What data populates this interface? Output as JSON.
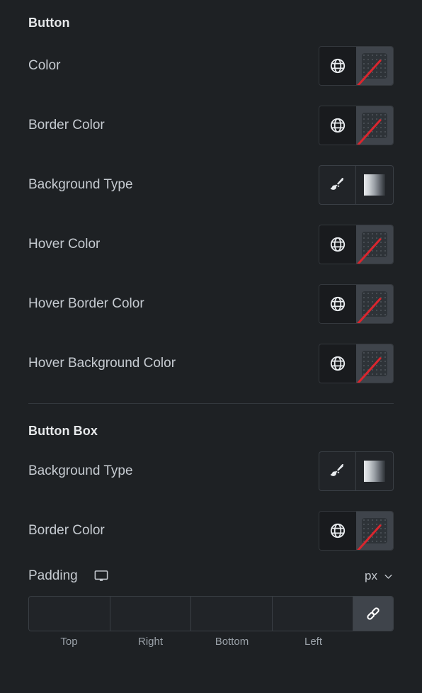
{
  "theme": {
    "background": "#1e2124",
    "panel_dark_cell": "#191b1e",
    "panel_light_cell": "#3f444b",
    "text_primary": "#e6e8ea",
    "text_label": "#c6cbd1",
    "text_muted": "#9aa1a8",
    "border": "#3a3f45",
    "accent_red": "#d9262e"
  },
  "sections": [
    {
      "title": "Button",
      "rows": [
        {
          "label": "Color",
          "control": "color-picker"
        },
        {
          "label": "Border Color",
          "control": "color-picker"
        },
        {
          "label": "Background Type",
          "control": "background-type"
        },
        {
          "label": "Hover Color",
          "control": "color-picker"
        },
        {
          "label": "Hover Border Color",
          "control": "color-picker"
        },
        {
          "label": "Hover Background Color",
          "control": "color-picker"
        }
      ]
    },
    {
      "title": "Button Box",
      "rows": [
        {
          "label": "Background Type",
          "control": "background-type"
        },
        {
          "label": "Border Color",
          "control": "color-picker"
        }
      ]
    }
  ],
  "padding": {
    "label": "Padding",
    "device_icon": "desktop-monitor-icon",
    "unit": "px",
    "unit_caret_icon": "chevron-down-icon",
    "link_icon": "link-chain-icon",
    "fields": [
      {
        "name": "top",
        "label": "Top",
        "value": "",
        "placeholder": ""
      },
      {
        "name": "right",
        "label": "Right",
        "value": "",
        "placeholder": ""
      },
      {
        "name": "bottom",
        "label": "Bottom",
        "value": "",
        "placeholder": ""
      },
      {
        "name": "left",
        "label": "Left",
        "value": "",
        "placeholder": ""
      }
    ]
  },
  "icons": {
    "globe": "globe-icon",
    "no_color_slash": "no-color-slash-icon",
    "brush": "paint-brush-icon",
    "gradient": "gradient-swatch-icon"
  }
}
